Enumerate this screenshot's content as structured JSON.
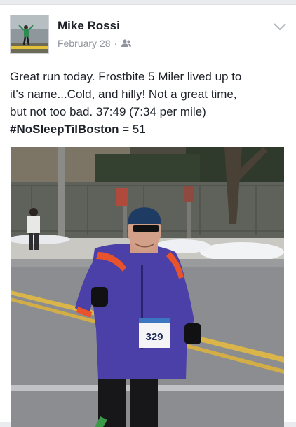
{
  "post": {
    "author": "Mike Rossi",
    "date": "February 28",
    "separator": "·",
    "privacy_icon": "friends-icon",
    "menu_icon": "chevron-down-icon",
    "text_line1": "Great run today.  Frostbite 5 Miler lived up to",
    "text_line2": "it's name...Cold, and hilly!  Not a great time,",
    "text_line3": "but not too bad.  37:49 (7:34 per mile)",
    "hashtag": "#NoSleepTilBoston",
    "hashtag_suffix": " = 51"
  },
  "photo": {
    "bib_number": "329"
  },
  "colors": {
    "text": "#1d2129",
    "meta": "#90949c",
    "jacket": "#4b3fa8",
    "jacket_stripe": "#e8532b"
  }
}
